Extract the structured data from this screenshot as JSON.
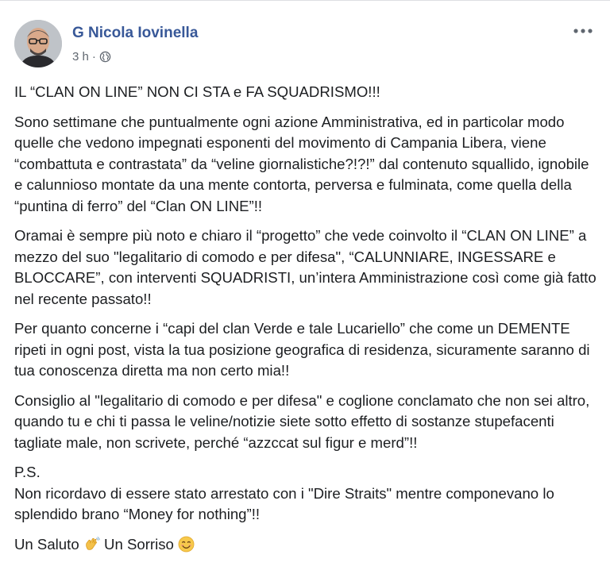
{
  "post": {
    "author": "G Nicola Iovinella",
    "time": "3 h",
    "separator": "·",
    "audience_icon": "globe-icon",
    "more_icon": "more-options-icon",
    "paragraphs": [
      "IL “CLAN ON LINE” NON CI STA e FA SQUADRISMO!!!",
      "Sono settimane che puntualmente ogni azione Amministrativa, ed in particolar modo quelle che vedono impegnati esponenti del movimento di Campania Libera, viene “combattuta e contrastata” da “veline giornalistiche?!?!” dal contenuto squallido, ignobile e calunnioso montate da una mente contorta, perversa e fulminata, come quella della “puntina di ferro” del “Clan ON LINE”!!",
      "Oramai è sempre più noto e chiaro il “progetto” che vede coinvolto il “CLAN ON LINE” a mezzo del suo \"legalitario di comodo e per difesa\", “CALUNNIARE, INGESSARE e BLOCCARE”, con interventi SQUADRISTI, un’intera Amministrazione così come già fatto nel recente passato!!",
      "Per quanto concerne i “capi del clan Verde e tale Lucariello” che come un DEMENTE ripeti in ogni post, vista la tua posizione geografica di residenza, sicuramente saranno di tua conoscenza diretta ma non certo mia!!",
      "Consiglio al \"legalitario di comodo e per difesa\" e coglione conclamato che non sei altro, quando tu e chi ti passa le veline/notizie siete sotto effetto di sostanze stupefacenti tagliate male, non scrivete, perché “azzccat sul figur e merd”!!",
      "P.S.",
      "Non ricordavo di essere stato arrestato con i \"Dire Straits\" mentre componevano lo splendido brano “Money for nothing”!!"
    ],
    "closing": {
      "part1": "Un Saluto",
      "emoji1": "waving-hand-icon",
      "part2": "Un Sorriso",
      "emoji2": "smiling-face-icon"
    }
  }
}
